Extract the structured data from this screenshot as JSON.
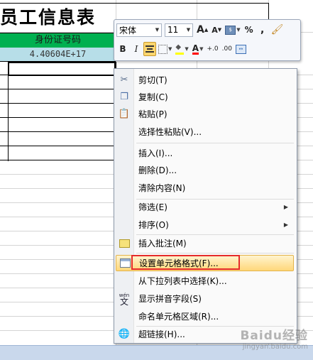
{
  "sheet": {
    "title": "员工信息表",
    "header": "身份证号码",
    "value": "4.40604E+17"
  },
  "mini_toolbar": {
    "font_name": "宋体",
    "font_size": "11",
    "bold": "B",
    "italic": "I",
    "percent": "%",
    "comma": ",",
    "grow_font": "A",
    "shrink_font": "A",
    "font_color_letter": "A",
    "inc_decimal": "+.0",
    "dec_decimal": ".00",
    "accent_highlight": "#ffd66e"
  },
  "context_menu": {
    "items": [
      {
        "label": "剪切(T)",
        "icon": "scissors-icon"
      },
      {
        "label": "复制(C)",
        "icon": "copy-icon"
      },
      {
        "label": "粘贴(P)",
        "icon": "paste-icon"
      },
      {
        "label": "选择性粘贴(V)..."
      },
      {
        "label": "插入(I)..."
      },
      {
        "label": "删除(D)..."
      },
      {
        "label": "清除内容(N)"
      },
      {
        "label": "筛选(E)",
        "submenu": true
      },
      {
        "label": "排序(O)",
        "submenu": true
      },
      {
        "label": "插入批注(M)",
        "icon": "comment-icon"
      },
      {
        "label": "设置单元格格式(F)...",
        "icon": "format-cells-icon",
        "highlighted": true
      },
      {
        "label": "从下拉列表中选择(K)..."
      },
      {
        "label": "显示拼音字段(S)",
        "icon": "phonetic-icon"
      },
      {
        "label": "命名单元格区域(R)..."
      },
      {
        "label": "超链接(H)...",
        "icon": "hyperlink-icon"
      }
    ],
    "highlight_color": "#e52b2b"
  },
  "watermark": {
    "brand": "Baidu经验",
    "url": "jingyan.baidu.com"
  }
}
